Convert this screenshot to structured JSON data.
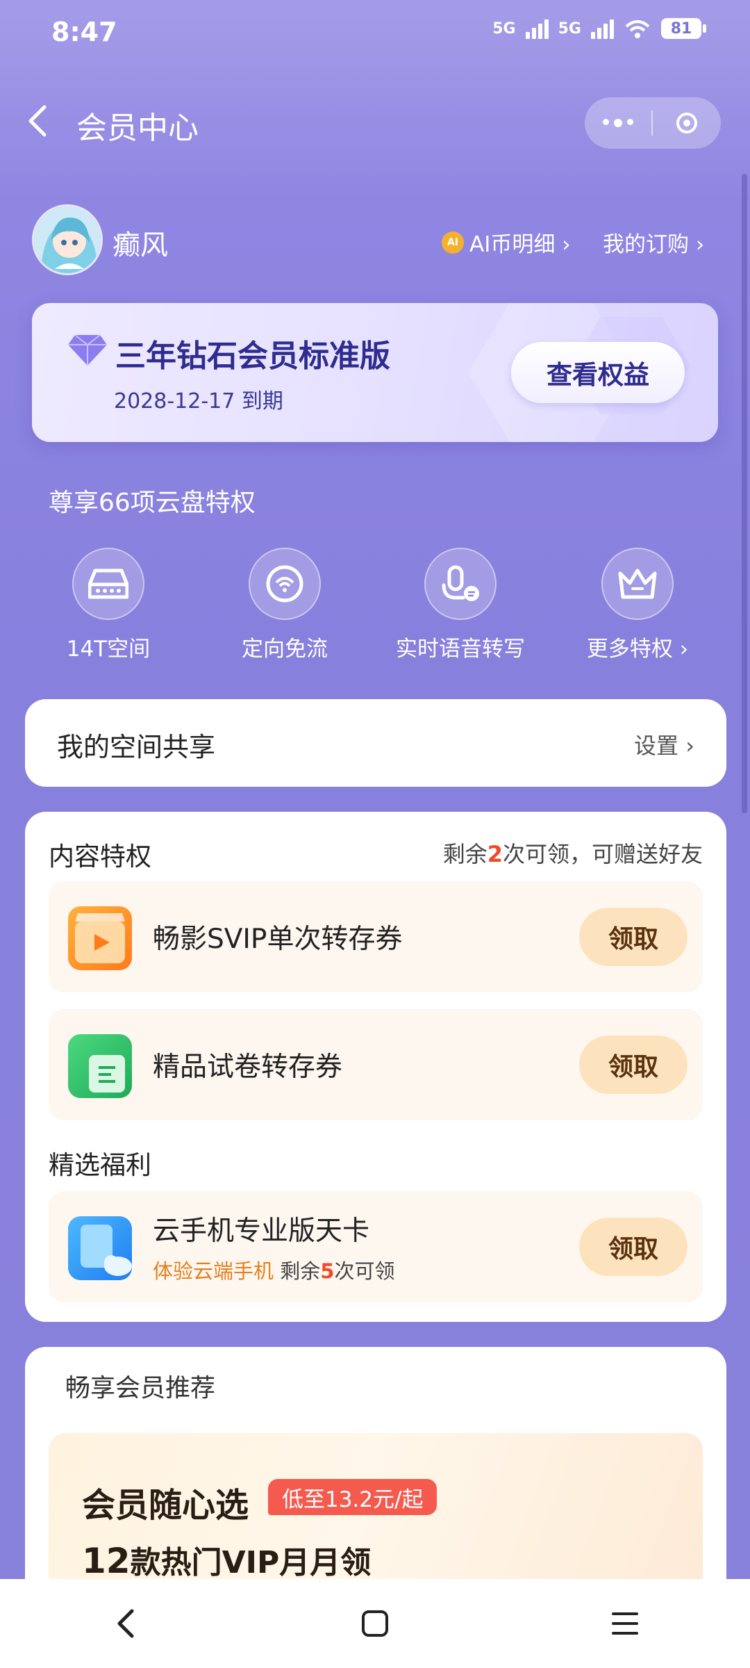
{
  "status_bar": {
    "time": "8:47",
    "network1": "5G",
    "network2": "5G",
    "battery": "81"
  },
  "header": {
    "title": "会员中心"
  },
  "profile": {
    "username": "癫风",
    "ai_badge": "AI",
    "ai_link": "AI币明细 ›",
    "subscription_link": "我的订购 ›"
  },
  "vip_card": {
    "name": "三年钻石会员标准版",
    "expiry": "2028-12-17 到期",
    "benefit_button": "查看权益"
  },
  "privileges": {
    "title": "尊享66项云盘特权",
    "items": [
      {
        "label": "14T空间",
        "icon": "storage-icon"
      },
      {
        "label": "定向免流",
        "icon": "signal-icon"
      },
      {
        "label": "实时语音转写",
        "icon": "microphone-icon"
      },
      {
        "label": "更多特权 ›",
        "icon": "crown-icon"
      }
    ]
  },
  "space_share": {
    "title": "我的空间共享",
    "setting": "设置 ›"
  },
  "content_privileges": {
    "title": "内容特权",
    "remain_prefix": "剩余",
    "remain_count": "2",
    "remain_suffix": "次可领，可赠送好友",
    "coupons": [
      {
        "title": "畅影SVIP单次转存券",
        "button": "领取",
        "icon": "video-icon"
      },
      {
        "title": "精品试卷转存券",
        "button": "领取",
        "icon": "document-icon"
      }
    ]
  },
  "selected_benefits": {
    "title": "精选福利",
    "items": [
      {
        "title": "云手机专业版天卡",
        "sub_highlight": "体验云端手机",
        "sub_prefix": "剩余",
        "sub_count": "5",
        "sub_suffix": "次可领",
        "button": "领取",
        "icon": "cloud-phone-icon"
      }
    ]
  },
  "recommend": {
    "title": "畅享会员推荐",
    "headline": "会员随心选",
    "tag": "低至13.2元/起",
    "subline_num": "12",
    "subline_text": "款热门VIP月月领"
  },
  "colors": {
    "accent": "#8780dd",
    "claim_bg": "#fde3bd",
    "red": "#f04a28",
    "orange": "#e5801e"
  }
}
